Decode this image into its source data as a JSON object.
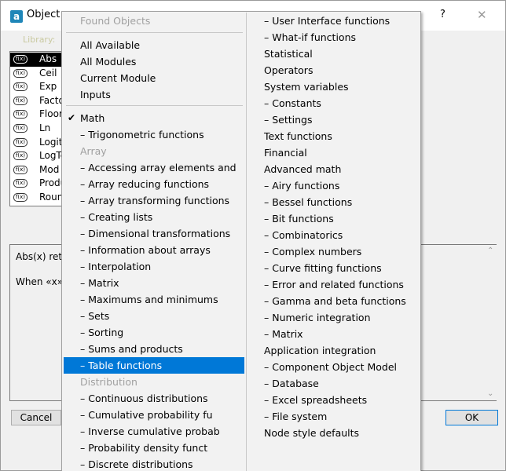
{
  "window": {
    "app_icon": "analytica-app-icon",
    "title": "Object",
    "help_label": "?",
    "close_label": "✕",
    "library_label": "Library:"
  },
  "function_list": [
    {
      "name": "Abs",
      "icon": "fx-icon",
      "selected": true
    },
    {
      "name": "Ceil",
      "icon": "fx-icon"
    },
    {
      "name": "Exp",
      "icon": "fx-icon"
    },
    {
      "name": "Facto",
      "icon": "fx-icon"
    },
    {
      "name": "Floor",
      "icon": "fx-icon"
    },
    {
      "name": "Ln",
      "icon": "fx-icon"
    },
    {
      "name": "Logit",
      "icon": "fx-icon"
    },
    {
      "name": "LogTe",
      "icon": "fx-icon"
    },
    {
      "name": "Mod",
      "icon": "fx-icon"
    },
    {
      "name": "Produ",
      "icon": "fx-icon"
    },
    {
      "name": "Roun",
      "icon": "fx-icon"
    }
  ],
  "description": {
    "line1": "Abs(x) retu",
    "line2": "When «x» i"
  },
  "buttons": {
    "cancel": "Cancel",
    "ok": "OK"
  },
  "menu": {
    "header": "Found Objects",
    "top_items": [
      "All Available",
      "All Modules",
      "Current Module",
      "Inputs"
    ],
    "checked_label": "✔",
    "column1": [
      {
        "label": "Math",
        "checked": true
      },
      {
        "label": "– Trigonometric functions"
      },
      {
        "label": "Array",
        "disabled": true
      },
      {
        "label": "– Accessing array elements and"
      },
      {
        "label": "– Array reducing functions"
      },
      {
        "label": "– Array transforming functions"
      },
      {
        "label": "– Creating lists"
      },
      {
        "label": "– Dimensional transformations"
      },
      {
        "label": "– Information about arrays"
      },
      {
        "label": "– Interpolation"
      },
      {
        "label": "– Matrix"
      },
      {
        "label": "– Maximums and minimums"
      },
      {
        "label": "– Sets"
      },
      {
        "label": "– Sorting"
      },
      {
        "label": "– Sums and products"
      },
      {
        "label": "– Table functions",
        "highlighted": true
      },
      {
        "label": "Distribution",
        "disabled": true
      },
      {
        "label": "– Continuous distributions"
      },
      {
        "label": "– Cumulative probability fu"
      },
      {
        "label": "– Inverse cumulative probab"
      },
      {
        "label": "– Probability density funct"
      },
      {
        "label": "– Discrete distributions"
      }
    ],
    "column2": [
      "– User Interface functions",
      "– What-if functions",
      "Statistical",
      "Operators",
      "System variables",
      "– Constants",
      "– Settings",
      "Text functions",
      "Financial",
      "Advanced math",
      "– Airy functions",
      "– Bessel functions",
      "– Bit functions",
      "– Combinatorics",
      "– Complex numbers",
      "– Curve fitting functions",
      "– Error and related functions",
      "– Gamma and beta functions",
      "– Numeric integration",
      "– Matrix",
      "Application integration",
      "– Component Object Model",
      "– Database",
      "– Excel spreadsheets",
      "– File system",
      "Node style defaults"
    ]
  }
}
